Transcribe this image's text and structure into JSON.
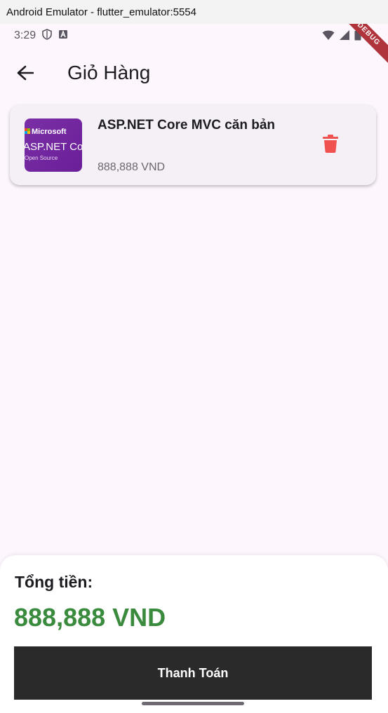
{
  "window": {
    "title": "Android Emulator - flutter_emulator:5554"
  },
  "status_bar": {
    "time": "3:29",
    "debug_label": "DEBUG"
  },
  "app_bar": {
    "title": "Giỏ Hàng"
  },
  "cart": {
    "items": [
      {
        "name": "ASP.NET Core MVC căn bản",
        "price": "888,888 VND",
        "thumbnail": {
          "brand": "Microsoft",
          "headline": "ASP.NET Cor",
          "caption": "Open Source"
        }
      }
    ]
  },
  "summary": {
    "total_label": "Tổng tiền:",
    "total_value": "888,888 VND",
    "checkout_label": "Thanh Toán"
  },
  "colors": {
    "accent_green": "#3a8b3e",
    "delete_red": "#f0524f",
    "checkout_bg": "#2a2a2a",
    "screen_bg": "#fdf6fd"
  }
}
